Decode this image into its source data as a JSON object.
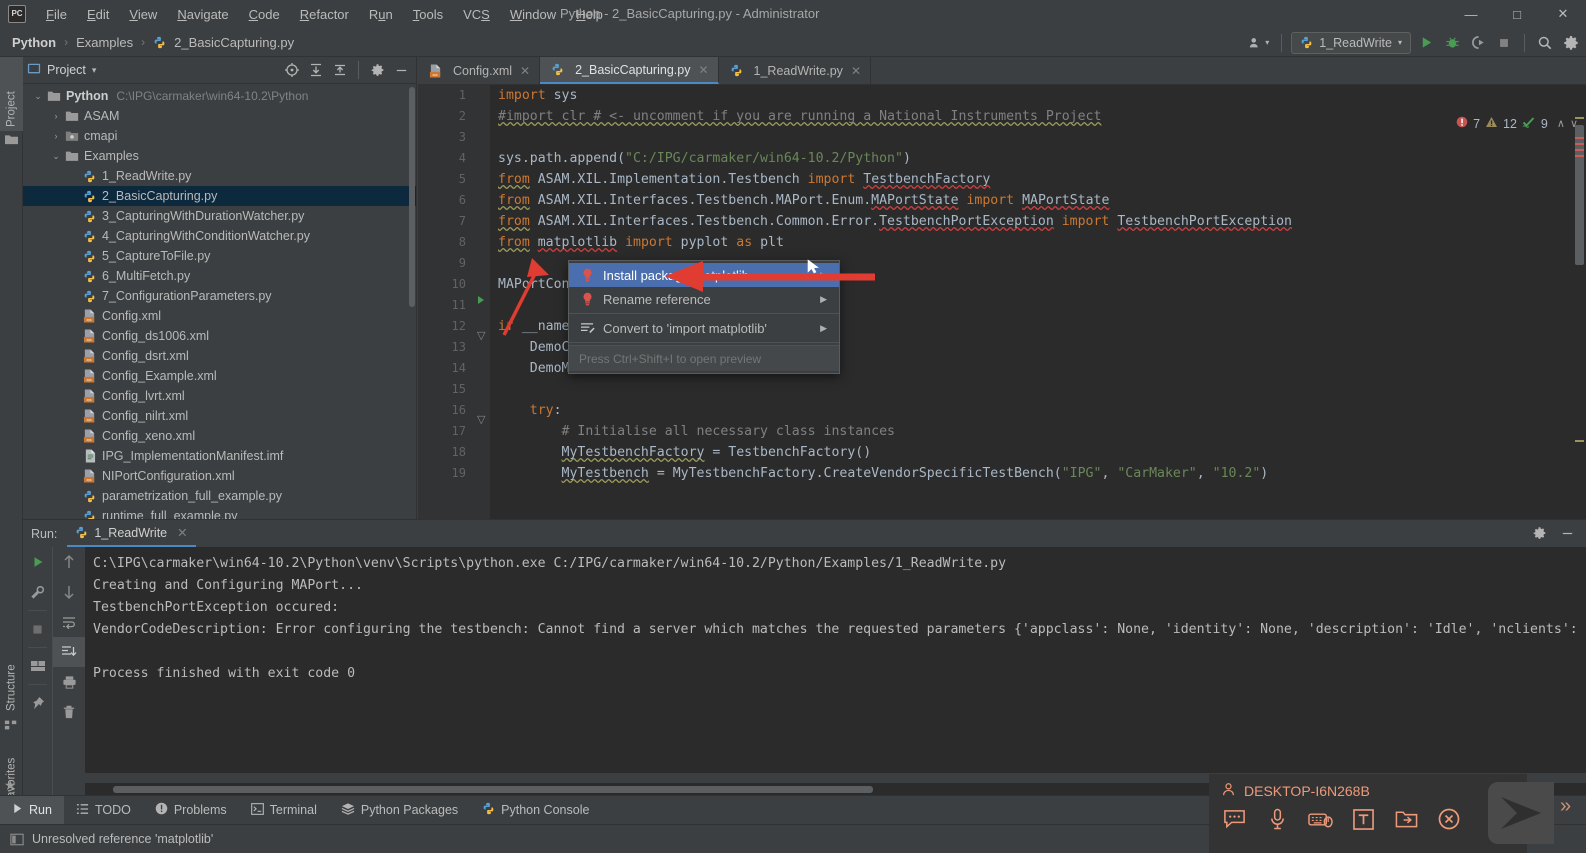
{
  "window": {
    "app_icon": "PC",
    "title": "Python - 2_BasicCapturing.py - Administrator",
    "minimize": "—",
    "maximize": "□",
    "close": "✕"
  },
  "menubar": [
    {
      "label": "File",
      "mnemonic": "F"
    },
    {
      "label": "Edit",
      "mnemonic": "E"
    },
    {
      "label": "View",
      "mnemonic": "V"
    },
    {
      "label": "Navigate",
      "mnemonic": "N"
    },
    {
      "label": "Code",
      "mnemonic": "C"
    },
    {
      "label": "Refactor",
      "mnemonic": "R"
    },
    {
      "label": "Run",
      "mnemonic": "u"
    },
    {
      "label": "Tools",
      "mnemonic": "T"
    },
    {
      "label": "VCS",
      "mnemonic": "S"
    },
    {
      "label": "Window",
      "mnemonic": "W"
    },
    {
      "label": "Help",
      "mnemonic": "H"
    }
  ],
  "breadcrumb": {
    "items": [
      "Python",
      "Examples",
      "2_BasicCapturing.py"
    ],
    "separator": "›",
    "file_icon": "python-file-icon"
  },
  "navbar_right": {
    "user_icon": "user-settings-icon",
    "run_config_label": "1_ReadWrite",
    "run_config_icon": "python-icon",
    "dropdown_caret": "▾",
    "run_icon": "run-icon",
    "debug_icon": "debug-icon",
    "coverage_icon": "run-with-coverage-icon",
    "stop_icon": "stop-icon",
    "search_icon": "search-icon",
    "settings_icon": "gear-icon"
  },
  "left_strip": {
    "tabs": [
      {
        "label": "Project",
        "icon": "project-icon",
        "active": true
      },
      {
        "label": "Structure",
        "icon": "structure-icon",
        "active": false
      },
      {
        "label": "Favorites",
        "icon": "star-icon",
        "active": false
      }
    ]
  },
  "project_panel": {
    "title": "Project",
    "title_icon": "project-icon",
    "dropdown_caret": "▾",
    "tools": [
      {
        "name": "select-opened-file-icon",
        "glyph": "⊕"
      },
      {
        "name": "expand-all-icon",
        "glyph": "↧"
      },
      {
        "name": "collapse-all-icon",
        "glyph": "↥"
      },
      {
        "name": "gear-icon",
        "glyph": "⚙"
      },
      {
        "name": "hide-icon",
        "glyph": "—"
      }
    ],
    "tree": [
      {
        "indent": 0,
        "arrow": "⌄",
        "icon": "folder-icon",
        "name": "Python",
        "bold": true,
        "path": "C:\\IPG\\carmaker\\win64-10.2\\Python",
        "selected": false
      },
      {
        "indent": 1,
        "arrow": "›",
        "icon": "folder-icon",
        "name": "ASAM",
        "bold": false,
        "path": "",
        "selected": false
      },
      {
        "indent": 1,
        "arrow": "›",
        "icon": "module-icon",
        "name": "cmapi",
        "bold": false,
        "path": "",
        "selected": false
      },
      {
        "indent": 1,
        "arrow": "⌄",
        "icon": "folder-icon",
        "name": "Examples",
        "bold": false,
        "path": "",
        "selected": false
      },
      {
        "indent": 2,
        "arrow": "",
        "icon": "python-file-icon",
        "name": "1_ReadWrite.py",
        "bold": false,
        "path": "",
        "selected": false
      },
      {
        "indent": 2,
        "arrow": "",
        "icon": "python-file-icon",
        "name": "2_BasicCapturing.py",
        "bold": false,
        "path": "",
        "selected": true
      },
      {
        "indent": 2,
        "arrow": "",
        "icon": "python-file-icon",
        "name": "3_CapturingWithDurationWatcher.py",
        "bold": false,
        "path": "",
        "selected": false
      },
      {
        "indent": 2,
        "arrow": "",
        "icon": "python-file-icon",
        "name": "4_CapturingWithConditionWatcher.py",
        "bold": false,
        "path": "",
        "selected": false
      },
      {
        "indent": 2,
        "arrow": "",
        "icon": "python-file-icon",
        "name": "5_CaptureToFile.py",
        "bold": false,
        "path": "",
        "selected": false
      },
      {
        "indent": 2,
        "arrow": "",
        "icon": "python-file-icon",
        "name": "6_MultiFetch.py",
        "bold": false,
        "path": "",
        "selected": false
      },
      {
        "indent": 2,
        "arrow": "",
        "icon": "python-file-icon",
        "name": "7_ConfigurationParameters.py",
        "bold": false,
        "path": "",
        "selected": false
      },
      {
        "indent": 2,
        "arrow": "",
        "icon": "xml-file-icon",
        "name": "Config.xml",
        "bold": false,
        "path": "",
        "selected": false
      },
      {
        "indent": 2,
        "arrow": "",
        "icon": "xml-file-icon",
        "name": "Config_ds1006.xml",
        "bold": false,
        "path": "",
        "selected": false
      },
      {
        "indent": 2,
        "arrow": "",
        "icon": "xml-file-icon",
        "name": "Config_dsrt.xml",
        "bold": false,
        "path": "",
        "selected": false
      },
      {
        "indent": 2,
        "arrow": "",
        "icon": "xml-file-icon",
        "name": "Config_Example.xml",
        "bold": false,
        "path": "",
        "selected": false
      },
      {
        "indent": 2,
        "arrow": "",
        "icon": "xml-file-icon",
        "name": "Config_lvrt.xml",
        "bold": false,
        "path": "",
        "selected": false
      },
      {
        "indent": 2,
        "arrow": "",
        "icon": "xml-file-icon",
        "name": "Config_nilrt.xml",
        "bold": false,
        "path": "",
        "selected": false
      },
      {
        "indent": 2,
        "arrow": "",
        "icon": "xml-file-icon",
        "name": "Config_xeno.xml",
        "bold": false,
        "path": "",
        "selected": false
      },
      {
        "indent": 2,
        "arrow": "",
        "icon": "text-file-icon",
        "name": "IPG_ImplementationManifest.imf",
        "bold": false,
        "path": "",
        "selected": false
      },
      {
        "indent": 2,
        "arrow": "",
        "icon": "xml-file-icon",
        "name": "NIPortConfiguration.xml",
        "bold": false,
        "path": "",
        "selected": false
      },
      {
        "indent": 2,
        "arrow": "",
        "icon": "python-file-icon",
        "name": "parametrization_full_example.py",
        "bold": false,
        "path": "",
        "selected": false
      },
      {
        "indent": 2,
        "arrow": "",
        "icon": "python-file-icon",
        "name": "runtime_full_example.py",
        "bold": false,
        "path": "",
        "selected": false
      }
    ]
  },
  "editor": {
    "tabs": [
      {
        "label": "Config.xml",
        "icon": "xml-file-icon",
        "active": false,
        "close": "✕"
      },
      {
        "label": "2_BasicCapturing.py",
        "icon": "python-file-icon",
        "active": true,
        "close": "✕"
      },
      {
        "label": "1_ReadWrite.py",
        "icon": "python-file-icon",
        "active": false,
        "close": "✕"
      }
    ],
    "inspection": {
      "error_icon": "error-icon",
      "error_count": "7",
      "warning_icon": "warning-icon",
      "warning_count": "12",
      "ok_icon": "inspections-ok-icon",
      "ok_count": "9",
      "prev_caret": "∧",
      "next_caret": "∨"
    },
    "line_numbers": [
      "1",
      "2",
      "3",
      "4",
      "5",
      "6",
      "7",
      "8",
      "9",
      "10",
      "11",
      "12",
      "13",
      "14",
      "15",
      "16",
      "17",
      "18",
      "19"
    ],
    "lines": [
      {
        "n": 1,
        "text": "import sys"
      },
      {
        "n": 2,
        "text": "#import clr # <- uncomment if you are running a National Instruments Project"
      },
      {
        "n": 3,
        "text": ""
      },
      {
        "n": 4,
        "text": "sys.path.append(\"C:/IPG/carmaker/win64-10.2/Python\")"
      },
      {
        "n": 5,
        "text": "from ASAM.XIL.Implementation.Testbench import TestbenchFactory"
      },
      {
        "n": 6,
        "text": "from ASAM.XIL.Interfaces.Testbench.MAPort.Enum.MAPortState import MAPortState"
      },
      {
        "n": 7,
        "text": "from ASAM.XIL.Interfaces.Testbench.Common.Error.TestbenchPortException import TestbenchPortException"
      },
      {
        "n": 8,
        "text": "from matplotlib import pyplot as plt"
      },
      {
        "n": 9,
        "text": ""
      },
      {
        "n": 10,
        "text": "MAPortConfi"
      },
      {
        "n": 11,
        "text": ""
      },
      {
        "n": 12,
        "text": "if __name_"
      },
      {
        "n": 13,
        "text": "    DemoCapture = None"
      },
      {
        "n": 14,
        "text": "    DemoMAPort = None"
      },
      {
        "n": 15,
        "text": ""
      },
      {
        "n": 16,
        "text": "    try:"
      },
      {
        "n": 17,
        "text": "        # Initialise all necessary class instances"
      },
      {
        "n": 18,
        "text": "        MyTestbenchFactory = TestbenchFactory()"
      },
      {
        "n": 19,
        "text": "        MyTestbench = MyTestbenchFactory.CreateVendorSpecificTestBench(\"IPG\", \"CarMaker\", \"10.2\")"
      }
    ]
  },
  "context_menu": {
    "items": [
      {
        "label": "Install package matplotlib",
        "icon": "bulb-error-icon",
        "selected": true,
        "submenu": true
      },
      {
        "label": "Rename reference",
        "icon": "bulb-error-icon",
        "selected": false,
        "submenu": true
      },
      {
        "label": "Convert to 'import matplotlib'",
        "icon": "intention-icon",
        "selected": false,
        "submenu": true
      }
    ],
    "hint": "Press Ctrl+Shift+I to open preview",
    "submenu_arrow": "▶",
    "highlight_color": "#4b6eaf"
  },
  "run_panel": {
    "label": "Run:",
    "tab_label": "1_ReadWrite",
    "tab_icon": "python-icon",
    "tab_close": "✕",
    "settings_icon": "gear-icon",
    "hide_icon": "—",
    "side_buttons": [
      {
        "name": "rerun-icon",
        "glyph": "▶",
        "active": false
      },
      {
        "name": "wrench-icon",
        "glyph": "🔧",
        "active": false
      },
      {
        "name": "stop-icon",
        "glyph": "■",
        "active": false
      },
      {
        "name": "layout-icon",
        "glyph": "▤",
        "active": false
      },
      {
        "name": "pin-icon",
        "glyph": "📌",
        "active": false
      }
    ],
    "side_buttons2": [
      {
        "name": "up-arrow-icon",
        "glyph": "↑",
        "active": false
      },
      {
        "name": "down-arrow-icon",
        "glyph": "↓",
        "active": false
      },
      {
        "name": "soft-wrap-icon",
        "glyph": "↩",
        "active": false
      },
      {
        "name": "scroll-to-end-icon",
        "glyph": "⇲",
        "active": true
      },
      {
        "name": "print-icon",
        "glyph": "⎙",
        "active": false
      },
      {
        "name": "clear-all-icon",
        "glyph": "🗑",
        "active": false
      }
    ],
    "output": [
      "C:\\IPG\\carmaker\\win64-10.2\\Python\\venv\\Scripts\\python.exe C:/IPG/carmaker/win64-10.2/Python/Examples/1_ReadWrite.py",
      "Creating and Configuring MAPort...",
      "TestbenchPortException occured:",
      "VendorCodeDescription: Error configuring the testbench: Cannot find a server which matches the requested parameters {'appclass': None, 'identity': None, 'description': 'Idle', 'nclients':",
      "",
      "Process finished with exit code 0"
    ]
  },
  "bottom_tabs": [
    {
      "label": "Run",
      "icon": "run-icon",
      "active": true
    },
    {
      "label": "TODO",
      "icon": "todo-icon",
      "active": false
    },
    {
      "label": "Problems",
      "icon": "problems-icon",
      "active": false
    },
    {
      "label": "Terminal",
      "icon": "terminal-icon",
      "active": false
    },
    {
      "label": "Python Packages",
      "icon": "packages-icon",
      "active": false
    },
    {
      "label": "Python Console",
      "icon": "python-console-icon",
      "active": false
    }
  ],
  "status_bar": {
    "icon": "event-log-icon",
    "message": "Unresolved reference 'matplotlib'"
  },
  "overlay_widget": {
    "user_icon": "person-icon",
    "machine_name": "DESKTOP-I6N268B",
    "accent_color": "#ed9a7a",
    "buttons": [
      {
        "name": "chat-icon",
        "glyph": "…"
      },
      {
        "name": "microphone-icon",
        "glyph": "♂"
      },
      {
        "name": "keyboard-mouse-icon",
        "glyph": "⌨"
      },
      {
        "name": "text-input-icon",
        "glyph": "T"
      },
      {
        "name": "file-transfer-icon",
        "glyph": "→"
      },
      {
        "name": "disconnect-icon",
        "glyph": "✕"
      }
    ],
    "expand_chevron": "»"
  }
}
